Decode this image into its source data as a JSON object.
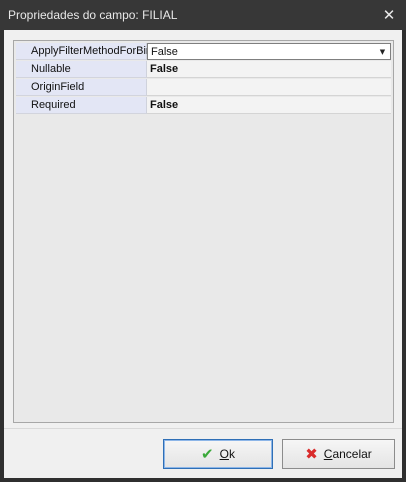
{
  "window": {
    "title": "Propriedades do campo: FILIAL",
    "close_icon": "close-icon"
  },
  "grid": {
    "rows": [
      {
        "name": "ApplyFilterMethodForBir",
        "value": "False",
        "selected": true,
        "has_dropdown": true
      },
      {
        "name": "Nullable",
        "value": "False",
        "bold": true
      },
      {
        "name": "OriginField",
        "value": ""
      },
      {
        "name": "Required",
        "value": "False",
        "bold": true
      }
    ]
  },
  "buttons": {
    "ok": {
      "label": "Ok",
      "icon": "check-icon",
      "icon_color": "#3aa93a"
    },
    "cancel": {
      "label": "Cancelar",
      "icon": "x-icon",
      "icon_color": "#d92b2b"
    }
  }
}
